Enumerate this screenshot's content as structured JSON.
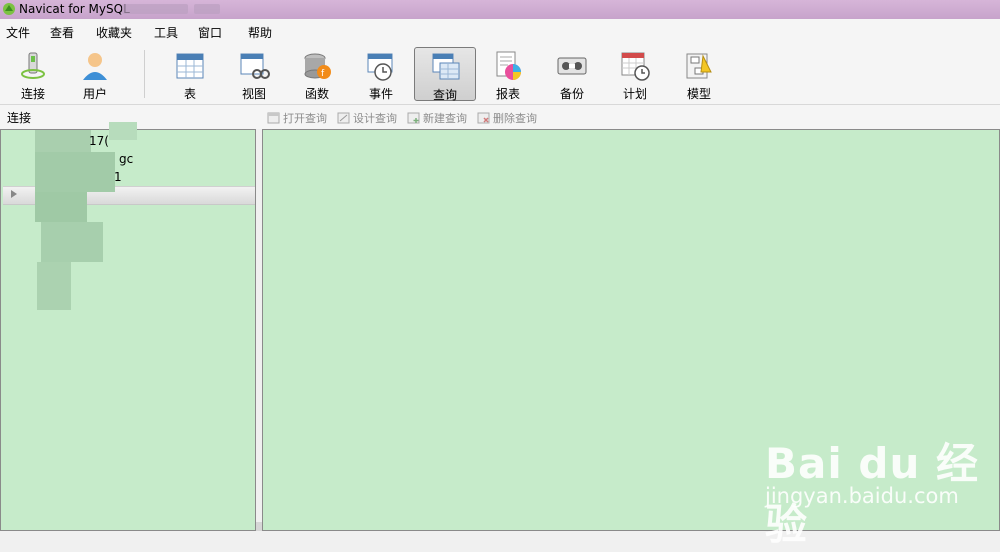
{
  "window": {
    "title": "Navicat for MySQL",
    "title_color": "#c7a3cb"
  },
  "menubar": {
    "items": [
      "文件",
      "查看",
      "收藏夹",
      "工具",
      "窗口",
      "帮助"
    ]
  },
  "toolbar": {
    "buttons": [
      {
        "label": "连接",
        "icon": "connection-icon"
      },
      {
        "label": "用户",
        "icon": "user-icon"
      },
      {
        "label": "表",
        "icon": "table-icon"
      },
      {
        "label": "视图",
        "icon": "view-icon"
      },
      {
        "label": "函数",
        "icon": "function-icon"
      },
      {
        "label": "事件",
        "icon": "event-icon"
      },
      {
        "label": "查询",
        "icon": "query-icon",
        "active": true
      },
      {
        "label": "报表",
        "icon": "report-icon"
      },
      {
        "label": "备份",
        "icon": "backup-icon"
      },
      {
        "label": "计划",
        "icon": "schedule-icon"
      },
      {
        "label": "模型",
        "icon": "model-icon"
      }
    ]
  },
  "subbar": {
    "connection_label": "连接",
    "actions": [
      "打开查询",
      "设计查询",
      "新建查询",
      "删除查询"
    ]
  },
  "tree": {
    "fragments": [
      "17(",
      "gc",
      "1"
    ]
  },
  "colors": {
    "panel_bg": "#c6ebca",
    "accent": "#4a7fb5"
  },
  "watermark": {
    "brand": "Bai du 经验",
    "url": "jingyan.baidu.com"
  }
}
